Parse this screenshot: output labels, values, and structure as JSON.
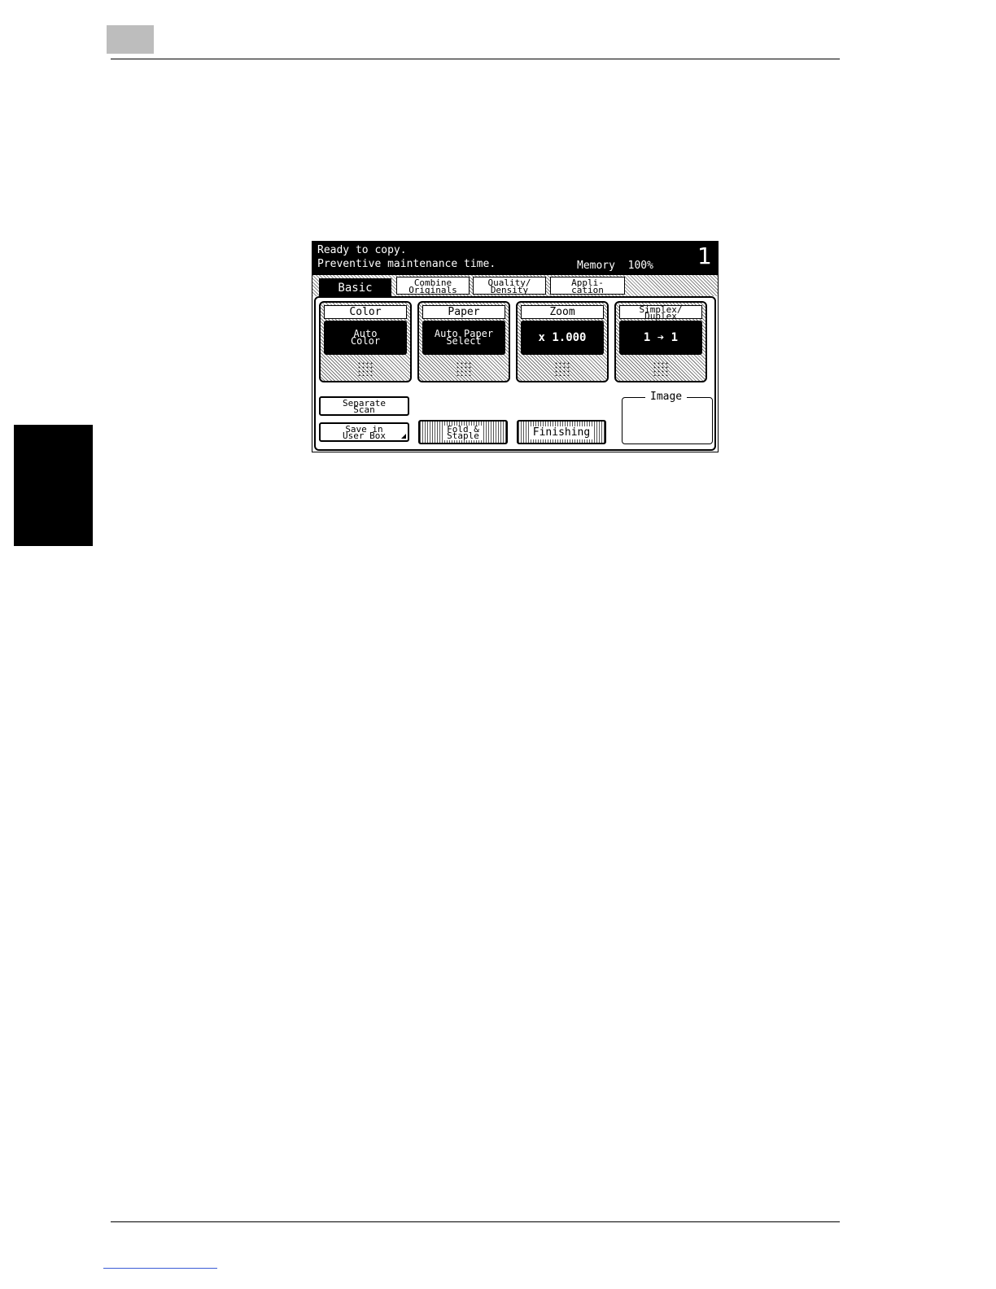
{
  "panel": {
    "status_line1": "Ready to copy.",
    "status_line2": "Preventive maintenance time.",
    "memory": "Memory  100%",
    "copy_count": "1",
    "tabs": [
      {
        "label": "Basic"
      },
      {
        "label": "Combine\nOriginals"
      },
      {
        "label": "Quality/\nDensity"
      },
      {
        "label": "Appli-\ncation"
      }
    ],
    "functions": [
      {
        "title": "Color",
        "value": "Auto\nColor"
      },
      {
        "title": "Paper",
        "value": "Auto Paper\nSelect"
      },
      {
        "title": "Zoom",
        "value": "x 1.000"
      },
      {
        "title": "Simplex/\nDuplex",
        "value": "1 ➔ 1"
      }
    ],
    "buttons": {
      "separate_scan": "Separate\nScan",
      "save_in_user_box": "Save in\nUser Box",
      "fold_staple": "Fold &\nStaple",
      "finishing": "Finishing"
    },
    "image_label": "Image"
  }
}
